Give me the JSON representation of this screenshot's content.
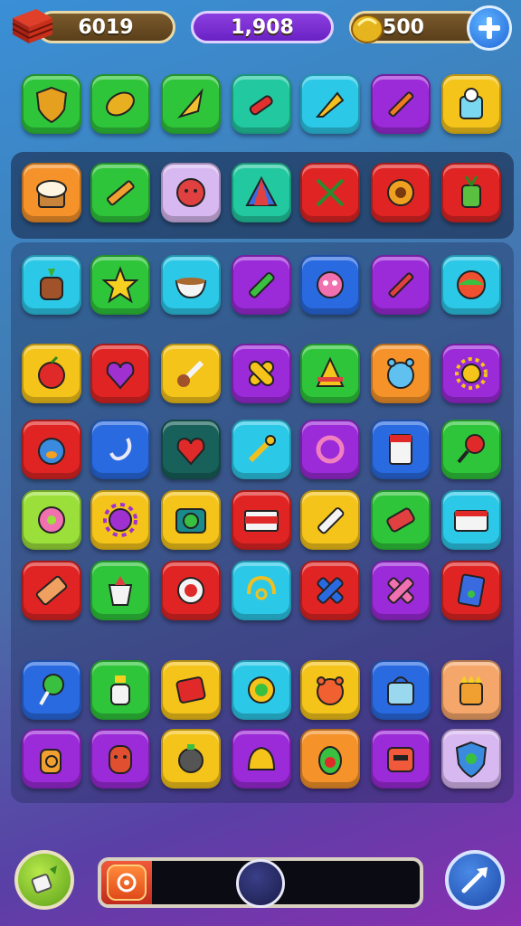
{
  "hud": {
    "coins": "6019",
    "gems": "1,908",
    "gold": "500"
  },
  "progress": 0.16,
  "colors": {
    "green": "#2fc53a",
    "lime": "#9be03a",
    "teal": "#22c9a0",
    "cyan": "#2cc8e8",
    "blue": "#2a6ae0",
    "purple": "#9b2ad8",
    "yellow": "#f5c41a",
    "orange": "#f5922a",
    "red": "#e02424",
    "darkteal": "#18605a",
    "lilac": "#d8b8f0",
    "peach": "#f5a66a"
  },
  "rows": [
    [
      {
        "color": "green",
        "icon": "shield-icon"
      },
      {
        "color": "green",
        "icon": "lemon-icon"
      },
      {
        "color": "green",
        "icon": "cone-icon"
      },
      {
        "color": "teal",
        "icon": "syringe-icon"
      },
      {
        "color": "cyan",
        "icon": "dart-icon"
      },
      {
        "color": "purple",
        "icon": "pencil-icon"
      },
      {
        "color": "yellow",
        "icon": "cup-icon"
      }
    ],
    [
      {
        "color": "orange",
        "icon": "muffin-icon"
      },
      {
        "color": "green",
        "icon": "crayon-icon"
      },
      {
        "color": "lilac",
        "icon": "blob-icon"
      },
      {
        "color": "teal",
        "icon": "tent-icon"
      },
      {
        "color": "red",
        "icon": "dragonfly-icon"
      },
      {
        "color": "red",
        "icon": "flower-icon"
      },
      {
        "color": "red",
        "icon": "plant-icon"
      }
    ],
    [
      {
        "color": "cyan",
        "icon": "pot-face-icon"
      },
      {
        "color": "green",
        "icon": "star-icon"
      },
      {
        "color": "cyan",
        "icon": "bowl-icon"
      },
      {
        "color": "purple",
        "icon": "marker-icon"
      },
      {
        "color": "blue",
        "icon": "monster-icon"
      },
      {
        "color": "purple",
        "icon": "pen-icon"
      },
      {
        "color": "cyan",
        "icon": "ball-icon"
      }
    ],
    [
      {
        "color": "yellow",
        "icon": "apple-icon"
      },
      {
        "color": "red",
        "icon": "heart-face-icon"
      },
      {
        "color": "yellow",
        "icon": "brush-icon"
      },
      {
        "color": "purple",
        "icon": "bandage-icon"
      },
      {
        "color": "green",
        "icon": "hat-icon"
      },
      {
        "color": "orange",
        "icon": "alarm-icon"
      },
      {
        "color": "purple",
        "icon": "sun-icon"
      }
    ],
    [
      {
        "color": "red",
        "icon": "penguin-icon"
      },
      {
        "color": "blue",
        "icon": "hook-icon"
      },
      {
        "color": "darkteal",
        "icon": "heart-icon"
      },
      {
        "color": "cyan",
        "icon": "wrench-icon"
      },
      {
        "color": "purple",
        "icon": "ring-icon"
      },
      {
        "color": "blue",
        "icon": "card-icon"
      },
      {
        "color": "green",
        "icon": "racket-icon"
      }
    ],
    [
      {
        "color": "lime",
        "icon": "donut-icon"
      },
      {
        "color": "yellow",
        "icon": "virus-icon"
      },
      {
        "color": "yellow",
        "icon": "camera-icon"
      },
      {
        "color": "red",
        "icon": "stripe-icon"
      },
      {
        "color": "yellow",
        "icon": "glue-icon"
      },
      {
        "color": "green",
        "icon": "tube-icon"
      },
      {
        "color": "cyan",
        "icon": "panel-icon"
      }
    ],
    [
      {
        "color": "red",
        "icon": "battery-icon"
      },
      {
        "color": "green",
        "icon": "yogurt-icon"
      },
      {
        "color": "red",
        "icon": "target-icon"
      },
      {
        "color": "cyan",
        "icon": "headset-icon"
      },
      {
        "color": "red",
        "icon": "cross-icon"
      },
      {
        "color": "purple",
        "icon": "ribbon-icon"
      },
      {
        "color": "red",
        "icon": "book-icon"
      }
    ],
    [
      {
        "color": "blue",
        "icon": "lollipop-icon"
      },
      {
        "color": "green",
        "icon": "toilet-icon"
      },
      {
        "color": "yellow",
        "icon": "box-icon"
      },
      {
        "color": "cyan",
        "icon": "coin-icon"
      },
      {
        "color": "yellow",
        "icon": "bear-icon"
      },
      {
        "color": "blue",
        "icon": "bag-icon"
      },
      {
        "color": "peach",
        "icon": "crown-face-icon"
      }
    ],
    [
      {
        "color": "purple",
        "icon": "jug-icon"
      },
      {
        "color": "purple",
        "icon": "mask-icon"
      },
      {
        "color": "yellow",
        "icon": "grenade-icon"
      },
      {
        "color": "purple",
        "icon": "bell-icon"
      },
      {
        "color": "orange",
        "icon": "avocado-icon"
      },
      {
        "color": "purple",
        "icon": "bot-icon"
      },
      {
        "color": "lilac",
        "icon": "badge-icon"
      }
    ]
  ]
}
